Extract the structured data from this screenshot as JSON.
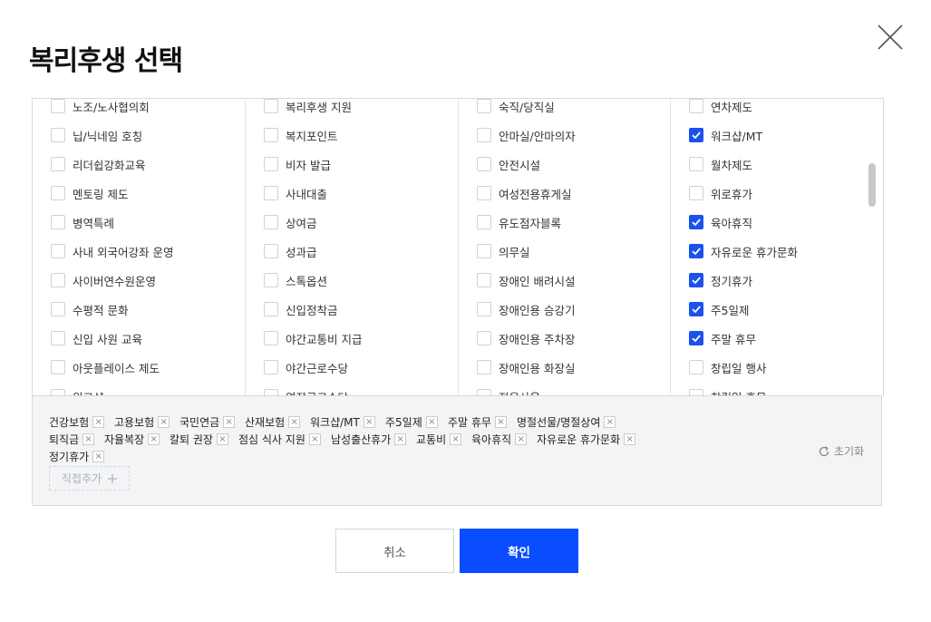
{
  "dialog": {
    "title": "복리후생 선택",
    "close_icon": "close-icon"
  },
  "columns": [
    [
      {
        "label": "노조/노사협의회",
        "checked": false
      },
      {
        "label": "닙/닉네임 호칭",
        "checked": false
      },
      {
        "label": "리더쉽강화교육",
        "checked": false
      },
      {
        "label": "멘토링 제도",
        "checked": false
      },
      {
        "label": "병역특례",
        "checked": false
      },
      {
        "label": "사내 외국어강좌 운영",
        "checked": false
      },
      {
        "label": "사이버연수원운영",
        "checked": false
      },
      {
        "label": "수평적 문화",
        "checked": false
      },
      {
        "label": "신입 사원 교육",
        "checked": false
      },
      {
        "label": "아웃플레이스 제도",
        "checked": false
      },
      {
        "label": "워크샵",
        "checked": false
      }
    ],
    [
      {
        "label": "복리후생 지원",
        "checked": false
      },
      {
        "label": "복지포인트",
        "checked": false
      },
      {
        "label": "비자 발급",
        "checked": false
      },
      {
        "label": "사내대출",
        "checked": false
      },
      {
        "label": "상여금",
        "checked": false
      },
      {
        "label": "성과급",
        "checked": false
      },
      {
        "label": "스톡옵션",
        "checked": false
      },
      {
        "label": "신입정착금",
        "checked": false
      },
      {
        "label": "야간교통비 지급",
        "checked": false
      },
      {
        "label": "야간근로수당",
        "checked": false
      },
      {
        "label": "연장근로수당",
        "checked": false
      }
    ],
    [
      {
        "label": "숙직/당직실",
        "checked": false
      },
      {
        "label": "안마실/안마의자",
        "checked": false
      },
      {
        "label": "안전시설",
        "checked": false
      },
      {
        "label": "여성전용휴게실",
        "checked": false
      },
      {
        "label": "유도점자블록",
        "checked": false
      },
      {
        "label": "의무실",
        "checked": false
      },
      {
        "label": "장애인 배려시설",
        "checked": false
      },
      {
        "label": "장애인용 승강기",
        "checked": false
      },
      {
        "label": "장애인용 주차장",
        "checked": false
      },
      {
        "label": "장애인용 화장실",
        "checked": false
      },
      {
        "label": "전용사옥",
        "checked": false
      }
    ],
    [
      {
        "label": "연차제도",
        "checked": false
      },
      {
        "label": "워크샵/MT",
        "checked": true
      },
      {
        "label": "월차제도",
        "checked": false
      },
      {
        "label": "위로휴가",
        "checked": false
      },
      {
        "label": "육아휴직",
        "checked": true
      },
      {
        "label": "자유로운 휴가문화",
        "checked": true
      },
      {
        "label": "정기휴가",
        "checked": true
      },
      {
        "label": "주5일제",
        "checked": true
      },
      {
        "label": "주말 휴무",
        "checked": true
      },
      {
        "label": "창립일 행사",
        "checked": false
      },
      {
        "label": "창립일 휴무",
        "checked": false
      }
    ]
  ],
  "selected_tags": [
    "건강보험",
    "고용보험",
    "국민연금",
    "산재보험",
    "워크샵/MT",
    "주5일제",
    "주말 휴무",
    "명절선물/명절상여",
    "퇴직금",
    "자율복장",
    "칼퇴 권장",
    "점심 식사 지원",
    "남성출산휴가",
    "교통비",
    "육아휴직",
    "자유로운 휴가문화",
    "정기휴가"
  ],
  "direct_add_label": "직접추가",
  "direct_add_icon": "plus-icon",
  "reset_label": "초기화",
  "reset_icon": "refresh-icon",
  "cancel_label": "취소",
  "confirm_label": "확인",
  "colors": {
    "accent": "#0a4cff",
    "checkbox_checked": "#1b52ee",
    "panel_bg": "#f3f4f6"
  }
}
